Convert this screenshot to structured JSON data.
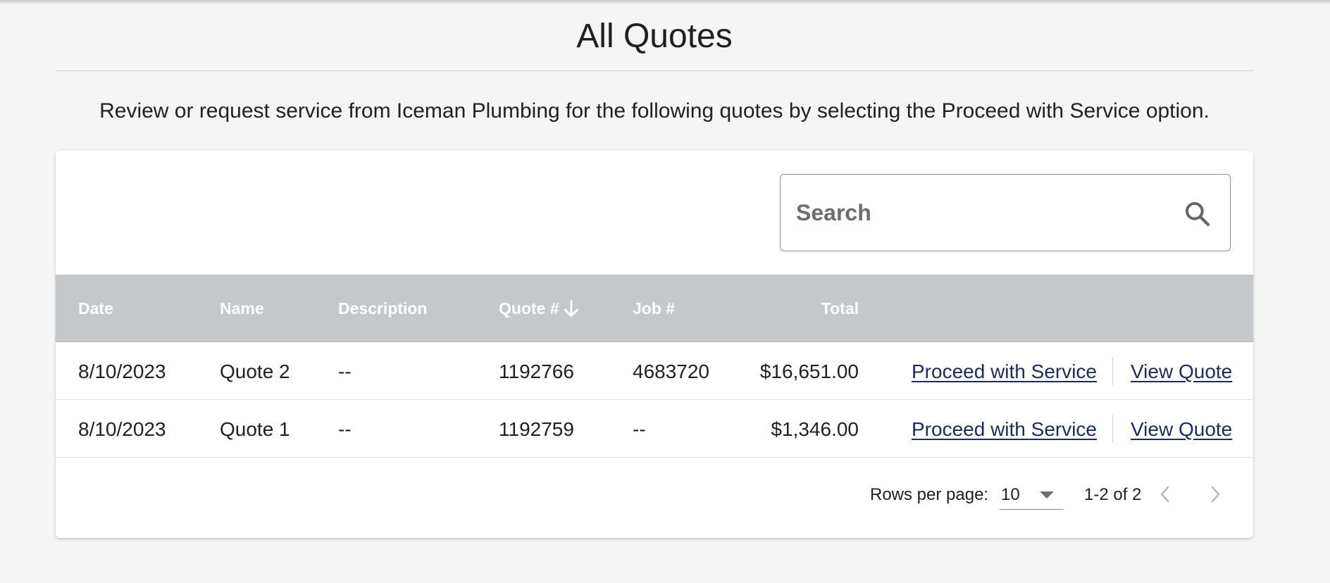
{
  "page": {
    "title": "All Quotes",
    "intro": "Review or request service from Iceman Plumbing for the following quotes by selecting the Proceed with Service option."
  },
  "search": {
    "placeholder": "Search",
    "icon": "search-icon"
  },
  "table": {
    "columns": [
      "Date",
      "Name",
      "Description",
      "Quote #",
      "Job #",
      "Total"
    ],
    "sort_column": "Quote #",
    "sort_direction": "descending",
    "rows": [
      {
        "date": "8/10/2023",
        "name": "Quote 2",
        "description": "--",
        "quote_no": "1192766",
        "job_no": "4683720",
        "total": "$16,651.00",
        "proceed_label": "Proceed with Service",
        "view_label": "View Quote"
      },
      {
        "date": "8/10/2023",
        "name": "Quote 1",
        "description": "--",
        "quote_no": "1192759",
        "job_no": "--",
        "total": "$1,346.00",
        "proceed_label": "Proceed with Service",
        "view_label": "View Quote"
      }
    ]
  },
  "pagination": {
    "rows_per_page_label": "Rows per page:",
    "rows_per_page": "10",
    "range": "1-2 of 2"
  },
  "colors": {
    "header_bg": "#c4c8cb",
    "link": "#1f2a5c",
    "page_bg": "#f4f5f4"
  }
}
